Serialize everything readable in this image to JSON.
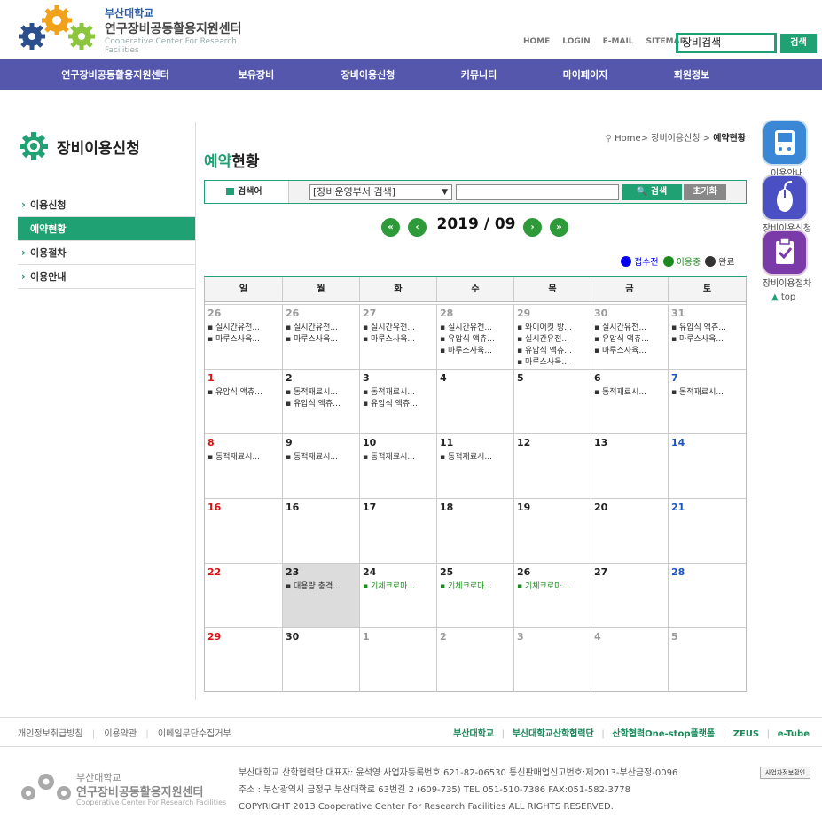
{
  "header": {
    "university": "부산대학교",
    "center_name": "연구장비공동활용지원센터",
    "center_eng": "Cooperative Center For Research Facilities",
    "util_links": [
      "HOME",
      "LOGIN",
      "E-MAIL",
      "SITEMAP"
    ],
    "search_value": "장비검색",
    "search_button": "검색"
  },
  "gnb": [
    "연구장비공동활용지원센터",
    "보유장비",
    "장비이용신청",
    "커뮤니티",
    "마이페이지",
    "회원정보"
  ],
  "lnb": {
    "title": "장비이용신청",
    "items": [
      {
        "label": "이용신청",
        "active": false
      },
      {
        "label": "예약현황",
        "active": true
      },
      {
        "label": "이용절차",
        "active": false
      },
      {
        "label": "이용안내",
        "active": false
      }
    ]
  },
  "breadcrumb": {
    "path": "Home> 장비이용신청 > ",
    "current": "예약현황"
  },
  "page_title": {
    "highlight": "예약",
    "rest": "현황"
  },
  "search": {
    "label": "검색어",
    "select_value": "[장비운영부서 검색]",
    "button": "검색",
    "reset": "초기화"
  },
  "calendar": {
    "month_label": "2019 / 09",
    "legend": [
      {
        "label": "접수전",
        "color": "#0000ee"
      },
      {
        "label": "이용중",
        "color": "#1c8a1c"
      },
      {
        "label": "완료",
        "color": "#333333"
      }
    ],
    "weekdays": [
      "일",
      "월",
      "화",
      "수",
      "목",
      "금",
      "토"
    ],
    "weeks": [
      [
        {
          "day": "26",
          "muted": true,
          "events": [
            "실시간유전...",
            "마루스사육..."
          ]
        },
        {
          "day": "26",
          "muted": true,
          "events": [
            "실시간유전...",
            "마루스사육..."
          ]
        },
        {
          "day": "27",
          "muted": true,
          "events": [
            "실시간유전...",
            "마루스사육..."
          ]
        },
        {
          "day": "28",
          "muted": true,
          "events": [
            "실시간유전...",
            "유압식 액츄...",
            "마루스사육..."
          ]
        },
        {
          "day": "29",
          "muted": true,
          "events": [
            "와이어컷 방...",
            "실시간유전...",
            "유압식 액츄...",
            "마루스사육..."
          ]
        },
        {
          "day": "30",
          "muted": true,
          "events": [
            "실시간유전...",
            "유압식 액츄...",
            "마루스사육..."
          ]
        },
        {
          "day": "31",
          "muted": true,
          "events": [
            "유압식 액츄...",
            "마루스사육..."
          ]
        }
      ],
      [
        {
          "day": "1",
          "events": [
            "유압식 액츄..."
          ]
        },
        {
          "day": "2",
          "events": [
            "동적재료시...",
            "유압식 액츄..."
          ]
        },
        {
          "day": "3",
          "events": [
            "동적재료시...",
            "유압식 액츄..."
          ]
        },
        {
          "day": "4",
          "events": []
        },
        {
          "day": "5",
          "events": []
        },
        {
          "day": "6",
          "events": [
            "동적재료시..."
          ]
        },
        {
          "day": "7",
          "events": [
            "동적재료시..."
          ]
        }
      ],
      [
        {
          "day": "8",
          "events": [
            "동적재료시..."
          ]
        },
        {
          "day": "9",
          "events": [
            "동적재료시..."
          ]
        },
        {
          "day": "10",
          "events": [
            "동적재료시..."
          ]
        },
        {
          "day": "11",
          "events": [
            "동적재료시..."
          ]
        },
        {
          "day": "12",
          "events": []
        },
        {
          "day": "13",
          "events": []
        },
        {
          "day": "14",
          "events": []
        }
      ],
      [
        {
          "day": "16",
          "events": []
        },
        {
          "day": "16",
          "events": []
        },
        {
          "day": "17",
          "events": []
        },
        {
          "day": "18",
          "events": []
        },
        {
          "day": "19",
          "events": []
        },
        {
          "day": "20",
          "events": []
        },
        {
          "day": "21",
          "events": []
        }
      ],
      [
        {
          "day": "22",
          "events": []
        },
        {
          "day": "23",
          "today": true,
          "events": [
            "대용량 충격..."
          ]
        },
        {
          "day": "24",
          "events": [
            "기체크로마..."
          ],
          "green": true
        },
        {
          "day": "25",
          "events": [
            "기체크로마..."
          ],
          "green": true
        },
        {
          "day": "26",
          "events": [
            "기체크로마..."
          ],
          "green": true
        },
        {
          "day": "27",
          "events": []
        },
        {
          "day": "28",
          "events": []
        }
      ],
      [
        {
          "day": "29",
          "events": []
        },
        {
          "day": "30",
          "events": []
        },
        {
          "day": "1",
          "muted": true,
          "events": []
        },
        {
          "day": "2",
          "muted": true,
          "events": []
        },
        {
          "day": "3",
          "muted": true,
          "events": []
        },
        {
          "day": "4",
          "muted": true,
          "events": []
        },
        {
          "day": "5",
          "muted": true,
          "events": []
        }
      ]
    ]
  },
  "quick_menu": [
    {
      "label": "이용안내",
      "color": "#3a87d6",
      "icon": "gamepad-icon"
    },
    {
      "label": "장비이용신청",
      "color": "#4b4fc4",
      "icon": "mouse-icon"
    },
    {
      "label": "장비이용절차",
      "color": "#7a3aa8",
      "icon": "clipboard-check-icon"
    }
  ],
  "top_link": "top",
  "footer": {
    "policy_links": [
      "개인정보취급방침",
      "이용약관",
      "이메일무단수집거부"
    ],
    "partner_links": [
      "부산대학교",
      "부산대학교산학협력단",
      "산학협력One-stop플랫폼",
      "ZEUS",
      "e-Tube"
    ],
    "logo_university": "부산대학교",
    "logo_center": "연구장비공동활용지원센터",
    "logo_eng": "Cooperative Center For Research Facilities",
    "info_lines": [
      "부산대학교 산학협력단 대표자: 윤석영   사업자등록번호:621-82-06530   통신판매업신고번호:제2013-부산금정-0096",
      "주소 : 부산광역시 금정구 부산대학로 63번길 2 (609-735)   TEL:051-510-7386    FAX:051-582-3778",
      "COPYRIGHT 2013 Cooperative Center For Research Facilities ALL RIGHTS RESERVED."
    ],
    "badge": "사업자정보확인"
  }
}
